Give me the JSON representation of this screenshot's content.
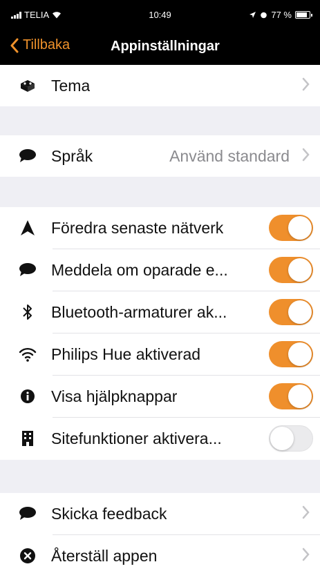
{
  "status": {
    "carrier": "TELIA",
    "time": "10:49",
    "battery": "77 %"
  },
  "nav": {
    "back_label": "Tillbaka",
    "title": "Appinställningar"
  },
  "rows": {
    "theme": {
      "label": "Tema",
      "icon": "paint-bucket-icon"
    },
    "language": {
      "label": "Språk",
      "value": "Använd standard",
      "icon": "speech-bubble-icon"
    },
    "prefer_network": {
      "label": "Föredra senaste nätverk",
      "icon": "arrow-up-icon",
      "on": true
    },
    "notify_unsaved": {
      "label": "Meddela om oparade e...",
      "icon": "speech-bubble-icon",
      "on": true
    },
    "bluetooth": {
      "label": "Bluetooth-armaturer ak...",
      "icon": "bluetooth-icon",
      "on": true
    },
    "hue": {
      "label": "Philips Hue aktiverad",
      "icon": "wifi-icon",
      "on": true
    },
    "help_buttons": {
      "label": "Visa hjälpknappar",
      "icon": "info-icon",
      "on": true
    },
    "site_functions": {
      "label": "Sitefunktioner aktivera...",
      "icon": "building-icon",
      "on": false
    },
    "feedback": {
      "label": "Skicka feedback",
      "icon": "speech-bubble-icon"
    },
    "reset": {
      "label": "Återställ appen",
      "icon": "close-circle-icon"
    }
  },
  "colors": {
    "accent": "#ef8f2c",
    "group_background": "#efeff4",
    "secondary_text": "#8a8a8e"
  }
}
